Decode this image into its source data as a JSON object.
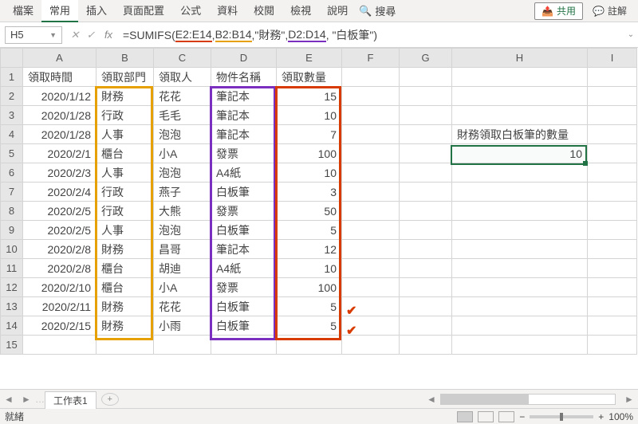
{
  "menu": {
    "tabs": [
      "檔案",
      "常用",
      "插入",
      "頁面配置",
      "公式",
      "資料",
      "校閱",
      "檢視",
      "說明"
    ],
    "search_label": "搜尋",
    "share_label": "共用",
    "note_label": "註解"
  },
  "formula_bar": {
    "name_box": "H5",
    "fx_label": "fx",
    "prefix": "=SUMIFS(",
    "arg1": "E2:E14",
    "sep1": ",",
    "arg2": "B2:B14",
    "sep2": ",\"財務\",",
    "arg3": "D2:D14",
    "suffix": ", \"白板筆\")"
  },
  "columns": [
    "A",
    "B",
    "C",
    "D",
    "E",
    "F",
    "G",
    "H",
    "I"
  ],
  "headers": {
    "A": "領取時間",
    "B": "領取部門",
    "C": "領取人",
    "D": "物件名稱",
    "E": "領取數量"
  },
  "rows": [
    {
      "r": "1",
      "A": "領取時間",
      "B": "領取部門",
      "C": "領取人",
      "D": "物件名稱",
      "E": "領取數量"
    },
    {
      "r": "2",
      "A": "2020/1/12",
      "B": "財務",
      "C": "花花",
      "D": "筆記本",
      "E": "15"
    },
    {
      "r": "3",
      "A": "2020/1/28",
      "B": "行政",
      "C": "毛毛",
      "D": "筆記本",
      "E": "10"
    },
    {
      "r": "4",
      "A": "2020/1/28",
      "B": "人事",
      "C": "泡泡",
      "D": "筆記本",
      "E": "7"
    },
    {
      "r": "5",
      "A": "2020/2/1",
      "B": "櫃台",
      "C": "小A",
      "D": "發票",
      "E": "100"
    },
    {
      "r": "6",
      "A": "2020/2/3",
      "B": "人事",
      "C": "泡泡",
      "D": "A4紙",
      "E": "10"
    },
    {
      "r": "7",
      "A": "2020/2/4",
      "B": "行政",
      "C": "燕子",
      "D": "白板筆",
      "E": "3"
    },
    {
      "r": "8",
      "A": "2020/2/5",
      "B": "行政",
      "C": "大熊",
      "D": "發票",
      "E": "50"
    },
    {
      "r": "9",
      "A": "2020/2/5",
      "B": "人事",
      "C": "泡泡",
      "D": "白板筆",
      "E": "5"
    },
    {
      "r": "10",
      "A": "2020/2/8",
      "B": "財務",
      "C": "昌哥",
      "D": "筆記本",
      "E": "12"
    },
    {
      "r": "11",
      "A": "2020/2/8",
      "B": "櫃台",
      "C": "胡迪",
      "D": "A4紙",
      "E": "10"
    },
    {
      "r": "12",
      "A": "2020/2/10",
      "B": "櫃台",
      "C": "小A",
      "D": "發票",
      "E": "100"
    },
    {
      "r": "13",
      "A": "2020/2/11",
      "B": "財務",
      "C": "花花",
      "D": "白板筆",
      "E": "5"
    },
    {
      "r": "14",
      "A": "2020/2/15",
      "B": "財務",
      "C": "小雨",
      "D": "白板筆",
      "E": "5"
    },
    {
      "r": "15"
    }
  ],
  "side": {
    "H4": "財務領取白板筆的數量",
    "H5": "10"
  },
  "sheet_tab": "工作表1",
  "status": {
    "ready": "就緒",
    "zoom": "100%"
  }
}
